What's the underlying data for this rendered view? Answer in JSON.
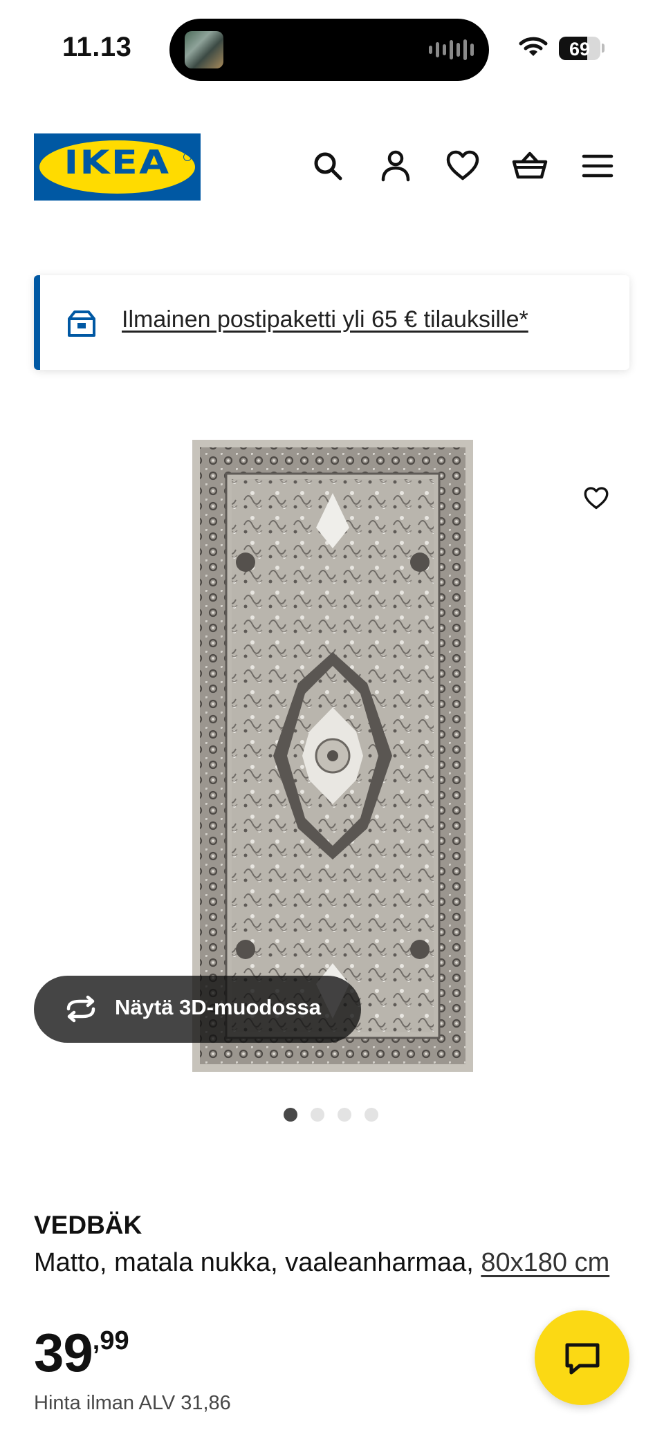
{
  "status_bar": {
    "time": "11.13",
    "battery": "69",
    "battery_level": 0.69
  },
  "header": {
    "logo_text": "IKEA",
    "icons": [
      "search-icon",
      "profile-icon",
      "heart-icon",
      "basket-icon",
      "menu-icon"
    ]
  },
  "banner": {
    "text": "Ilmainen postipaketti yli 65 € tilauksille*"
  },
  "gallery": {
    "view_3d_label": "Näytä 3D-muodossa",
    "slide_count": 4,
    "active_slide": 1
  },
  "product": {
    "name": "VEDBÄK",
    "description": "Matto, matala nukka, vaaleanharmaa,",
    "size": "80x180 cm",
    "price_integer": "39",
    "price_decimal": ",99",
    "price_ex_vat": "Hinta ilman ALV 31,86"
  },
  "colors": {
    "ikea_blue": "#0058a3",
    "ikea_yellow": "#ffdb00",
    "chat_yellow": "#fbd914"
  }
}
